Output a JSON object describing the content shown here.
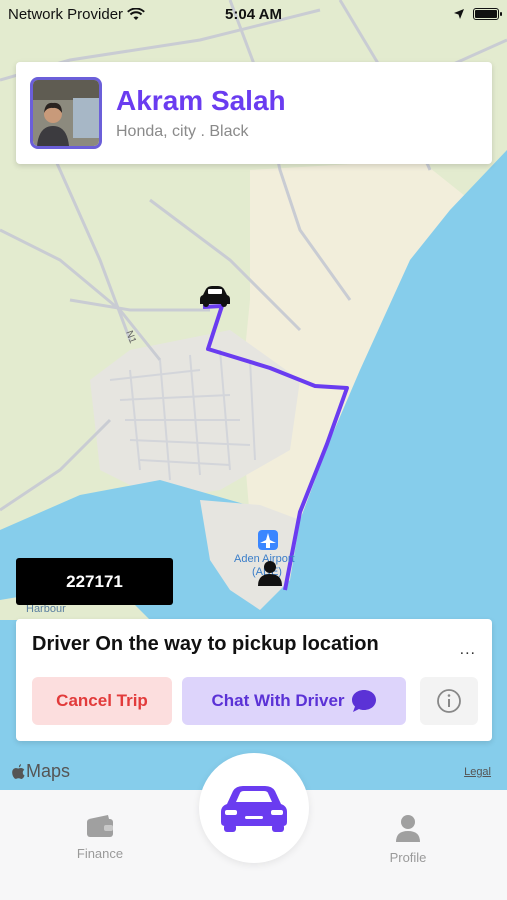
{
  "status_bar": {
    "carrier": "Network Provider",
    "time": "5:04 AM"
  },
  "driver": {
    "name": "Akram Salah",
    "car": "Honda, city . Black"
  },
  "trip_code": "227171",
  "trip": {
    "status": "Driver On the way to pickup location",
    "more": "...",
    "cancel_label": "Cancel Trip",
    "chat_label": "Chat With  Driver"
  },
  "map": {
    "attribution": "Maps",
    "legal": "Legal",
    "labels": {
      "road": "N1",
      "airport": "Aden Airport",
      "airport_code": "(ADE)",
      "harbour": "Harbour"
    },
    "colors": {
      "land": "#f4f1e4",
      "green": "#e3ebcf",
      "sea": "#86cdeb",
      "route": "#6a3cf0",
      "road": "#c9ccd3",
      "urban": "#e6e5e0"
    }
  },
  "tabs": {
    "finance": "Finance",
    "profile": "Profile"
  },
  "theme": {
    "accent": "#6a3cf0",
    "cancel_text": "#e23b3b",
    "cancel_bg": "#fcdede",
    "chat_bg": "#ddd4fb"
  },
  "icons": [
    "wifi-icon",
    "location-arrow-icon",
    "battery-icon",
    "car-icon",
    "person-icon",
    "airport-icon",
    "chat-bubble-icon",
    "info-icon",
    "wallet-icon",
    "profile-icon",
    "apple-icon"
  ]
}
